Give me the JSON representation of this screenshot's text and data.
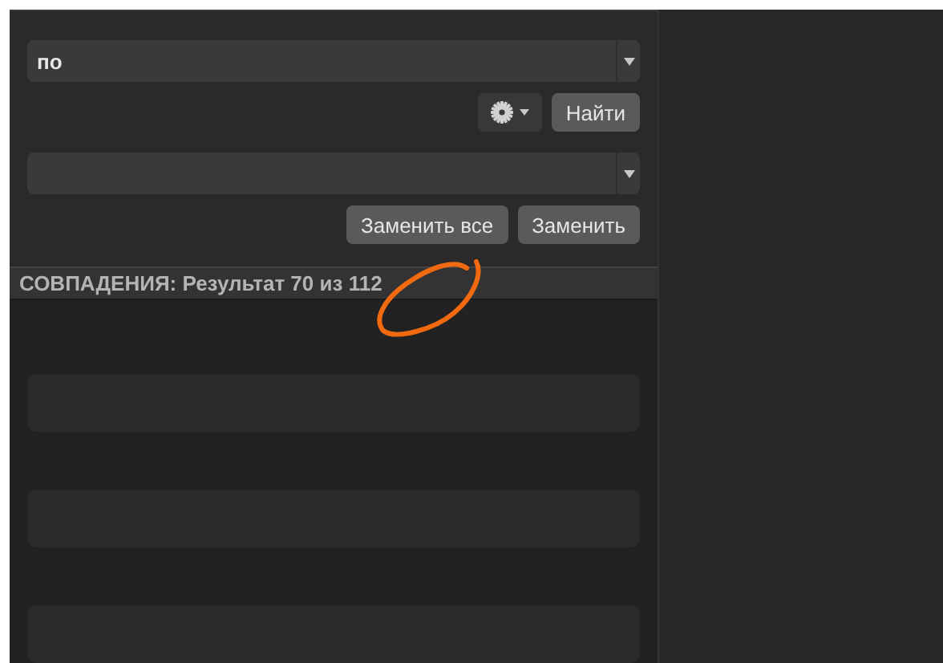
{
  "find_field": {
    "value": "по"
  },
  "options_button": {
    "has_menu": true
  },
  "find_button": {
    "label": "Найти"
  },
  "replace_field": {
    "kind": "combo"
  },
  "replace_buttons": [
    {
      "label": "Заменить все"
    },
    {
      "label": "Заменить"
    }
  ],
  "matches_header": {
    "label": "СОВПАДЕНИЯ: Результат 70 из 112"
  },
  "results": [
    {
      "kind": "placeholder"
    },
    {
      "kind": "placeholder"
    },
    {
      "kind": "placeholder"
    }
  ]
}
